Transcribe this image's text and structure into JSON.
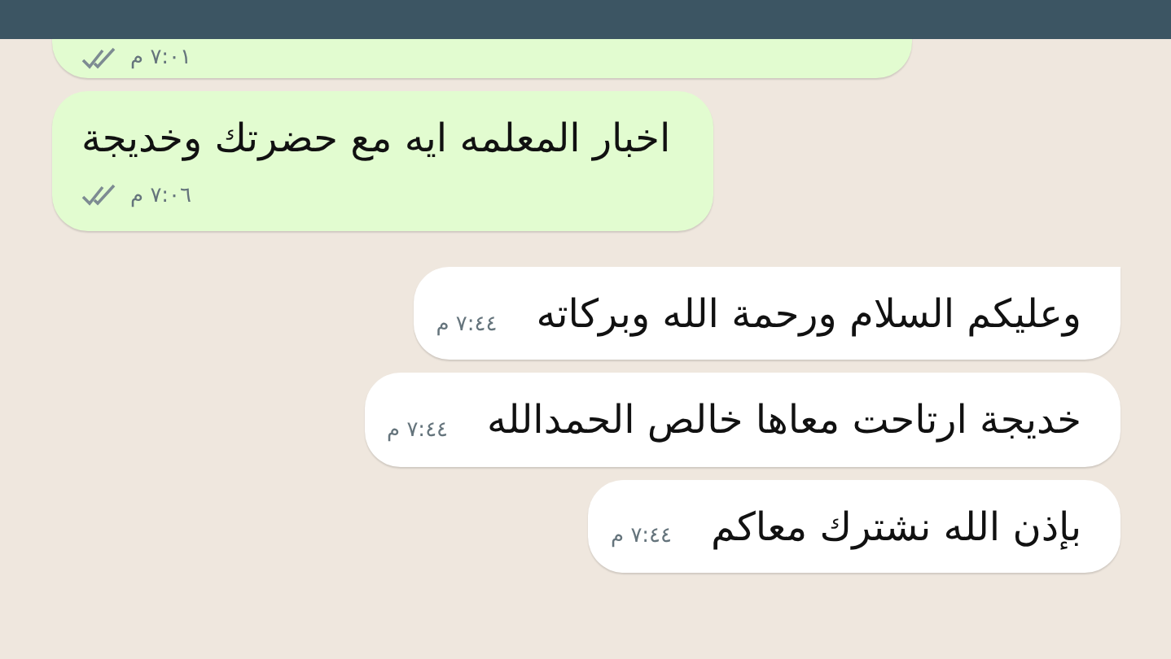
{
  "messages": [
    {
      "kind": "outgoing",
      "time": "٧:٠١ م",
      "read": false
    },
    {
      "kind": "outgoing",
      "text": "اخبار المعلمه ايه مع حضرتك وخديجة",
      "time": "٧:٠٦ م",
      "read": false
    },
    {
      "kind": "incoming",
      "text": "وعليكم السلام ورحمة الله وبركاته",
      "time": "٧:٤٤ م",
      "tail": true
    },
    {
      "kind": "incoming",
      "text": "خديجة ارتاحت معاها خالص الحمدالله",
      "time": "٧:٤٤ م",
      "tail": false
    },
    {
      "kind": "incoming",
      "text": "بإذن الله نشترك معاكم",
      "time": "٧:٤٤ م",
      "tail": false
    }
  ]
}
